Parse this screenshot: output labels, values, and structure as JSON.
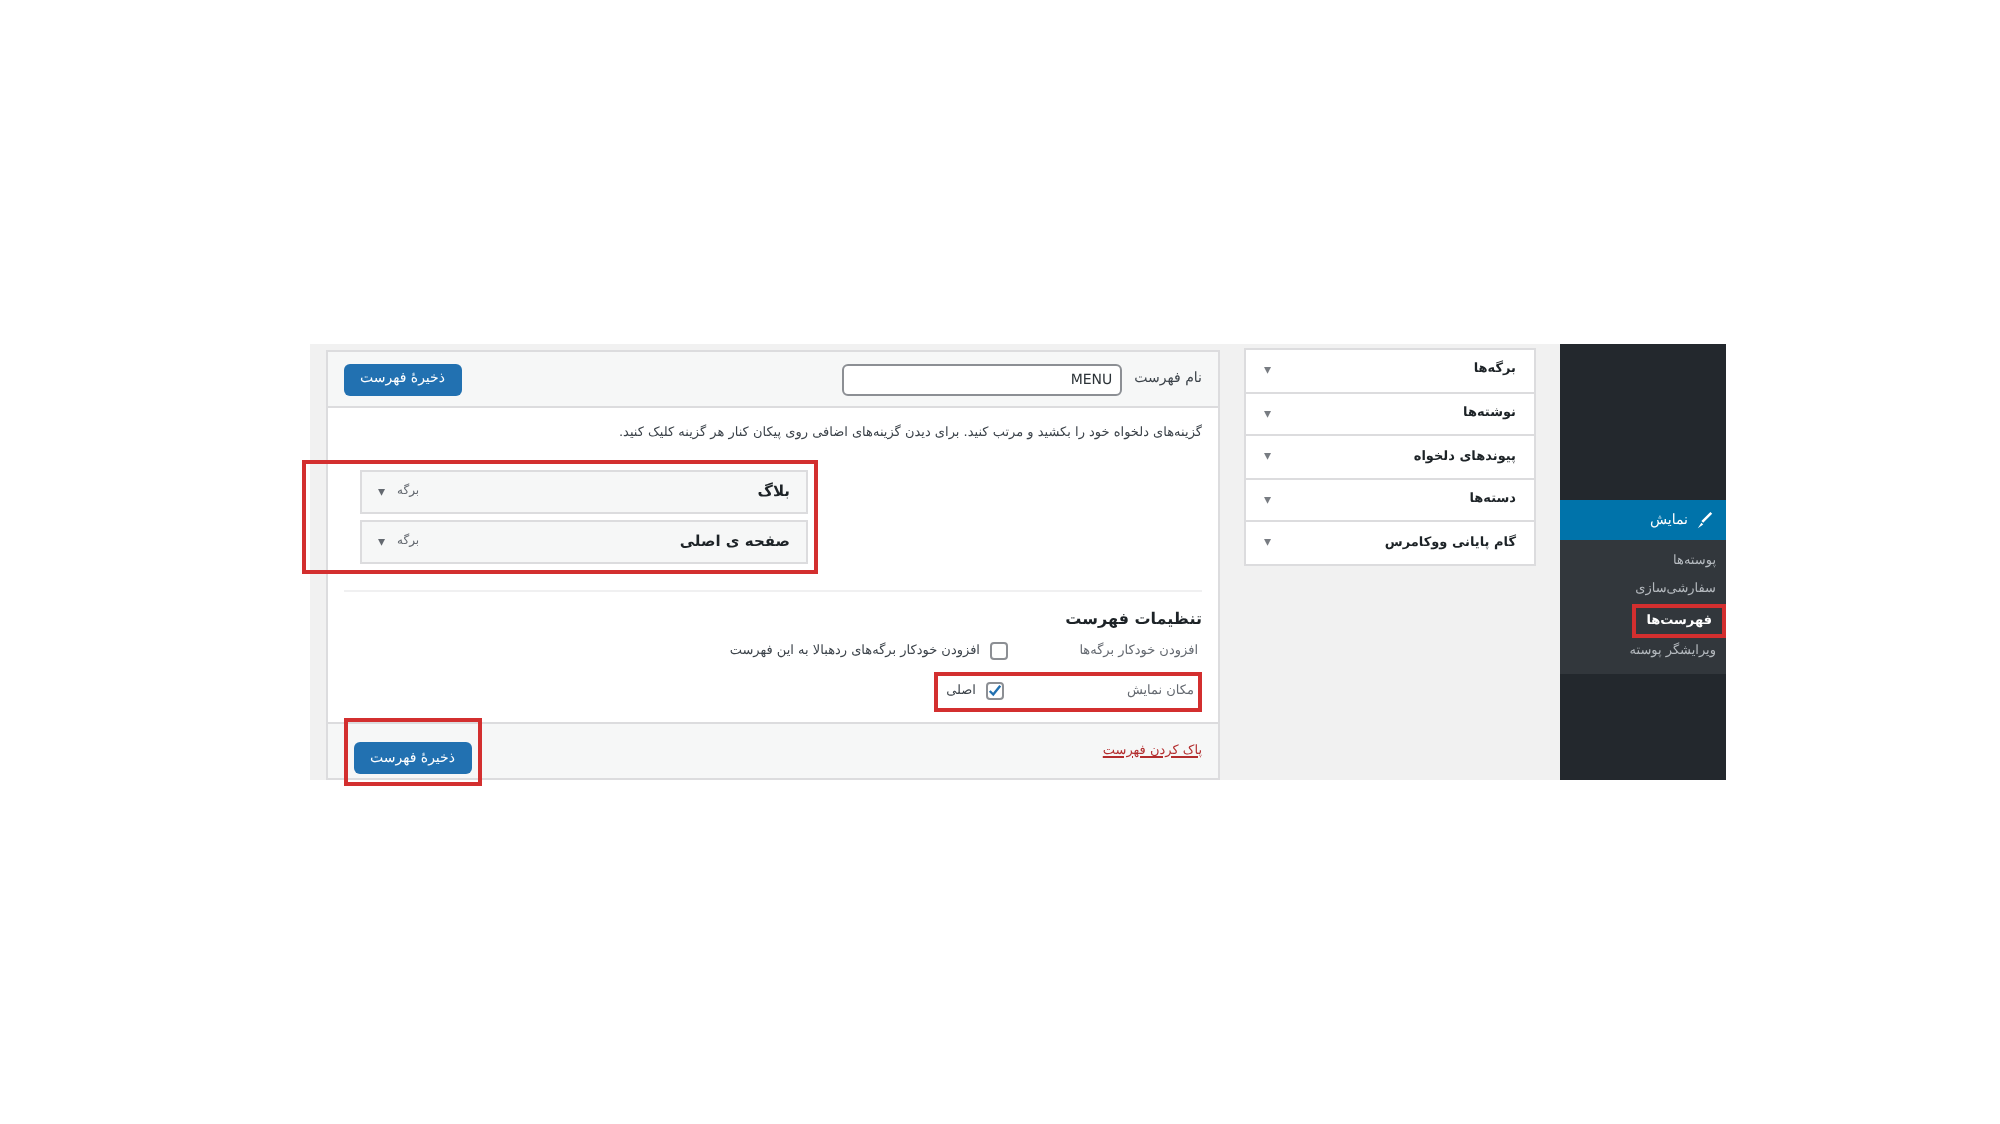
{
  "menu_name": {
    "label": "نام فهرست",
    "value": "MENU"
  },
  "save_button_top": {
    "label": "ذخیرهٔ فهرست",
    "highlighted": false
  },
  "instructions": "گزینه‌های دلخواه خود را بکشید و مرتب کنید. برای دیدن گزینه‌های اضافی روی پیکان کنار هر گزینه کلیک کنید.",
  "menu_items_highlighted": true,
  "menu_items": [
    {
      "title": "بلاگ",
      "type": "برگه",
      "caret": "▾"
    },
    {
      "title": "صفحه ی اصلی",
      "type": "برگه",
      "caret": "▾"
    }
  ],
  "settings": {
    "heading": "تنظیمات فهرست",
    "rows": [
      {
        "label": "افزودن خودکار برگه‌ها",
        "option": "افزودن خودکار برگه‌های ردهبالا به این فهرست",
        "checked": false,
        "highlighted": false
      },
      {
        "label": "مکان نمایش",
        "option": "اصلی",
        "checked": true,
        "highlighted": true
      }
    ]
  },
  "delete_link": "پاک کردن فهرست",
  "save_button_bottom": {
    "label": "ذخیرهٔ فهرست",
    "highlighted": true
  },
  "accordion": [
    {
      "label": "برگه‌ها",
      "caret": "▾"
    },
    {
      "label": "نوشته‌ها",
      "caret": "▾"
    },
    {
      "label": "پیوندهای دلخواه",
      "caret": "▾"
    },
    {
      "label": "دسته‌ها",
      "caret": "▾"
    },
    {
      "label": "گام پایانی ووکامرس",
      "caret": "▾"
    }
  ],
  "sidebar": {
    "parent": "نمایش",
    "items": [
      {
        "label": "پوسته‌ها",
        "selected": false,
        "highlighted": false
      },
      {
        "label": "سفارشی‌سازی",
        "selected": false,
        "highlighted": false
      },
      {
        "label": "فهرست‌ها",
        "selected": true,
        "highlighted": true
      },
      {
        "label": "ویرایشگر پوسته",
        "selected": false,
        "highlighted": false
      }
    ]
  }
}
